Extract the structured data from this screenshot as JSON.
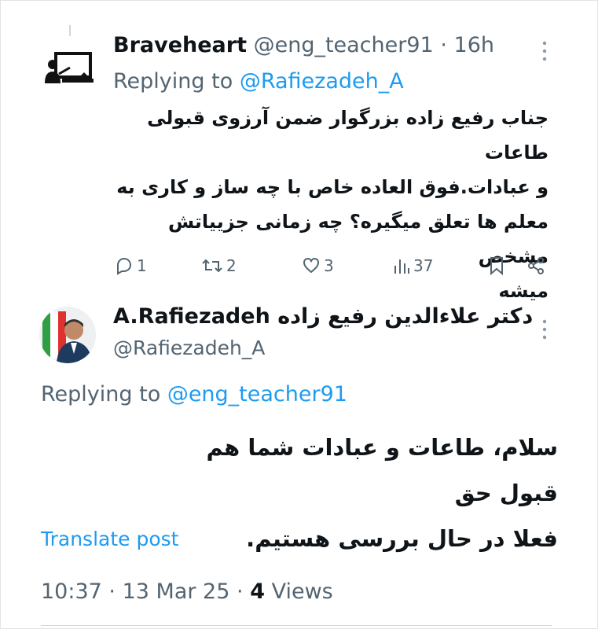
{
  "tweet1": {
    "display_name": "Braveheart",
    "handle": "@eng_teacher91",
    "separator": "·",
    "time_ago": "16h",
    "replying_to_label": "Replying to",
    "replying_to_handle": "@Rafiezadeh_A",
    "body_lines": [
      "جناب رفیع زاده بزرگوار ضمن آرزوی قبولی طاعات",
      "و عبادات.فوق العاده خاص با چه ساز و کاری به",
      "معلم ها تعلق میگیره؟ چه زمانی جزییاتش مشخص",
      "میشه"
    ],
    "actions": {
      "reply_icon": "reply-bubble-icon",
      "reply_count": "1",
      "repost_icon": "repost-icon",
      "repost_count": "2",
      "like_icon": "heart-icon",
      "like_count": "3",
      "views_icon": "bar-chart-icon",
      "views_count": "37",
      "bookmark_icon": "bookmark-icon",
      "share_icon": "share-icon"
    }
  },
  "tweet2": {
    "display_name": "A.Rafiezadeh دکتر علاءالدین رفیع زاده",
    "handle": "@Rafiezadeh_A",
    "replying_to_label": "Replying to",
    "replying_to_handle": "@eng_teacher91",
    "body_lines": [
      "سلام، طاعات و عبادات شما هم قبول حق",
      "فعلا در حال بررسی هستیم."
    ],
    "translate_label": "Translate post",
    "time": "10:37",
    "separator": "·",
    "date": "13 Mar 25",
    "views_count": "4",
    "views_label": "Views"
  },
  "colors": {
    "text_primary": "#0f1419",
    "text_secondary": "#536471",
    "link": "#1d9bf0"
  }
}
